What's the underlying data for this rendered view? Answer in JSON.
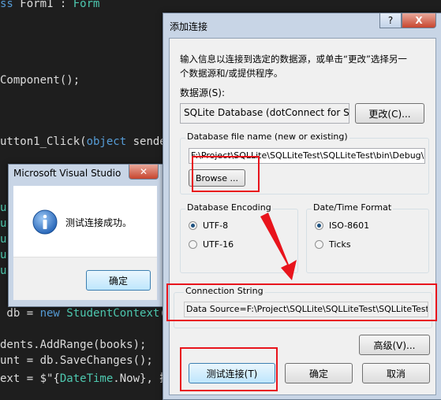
{
  "code_lines": {
    "l1_kw": "ss",
    "l1_name": " Form1 : ",
    "l1_type": "Form",
    "l2": "Component();",
    "l3_pre": "utton1_Click(",
    "l3_kw": "object",
    "l3_post": " sender",
    "l4_pre": " db = ",
    "l4_kw": "new",
    "l4_type": " StudentContext",
    "l4_post": "()",
    "l5": "dents.AddRange(books);",
    "l6": "unt = db.SaveChanges();",
    "l7_pre": "ext = $\"{",
    "l7_type": "DateTime",
    "l7_mid": ".Now}, 插"
  },
  "msgbox": {
    "title": "Microsoft Visual Studio",
    "message": "测试连接成功。",
    "ok_label": "确定",
    "icon": "info-icon"
  },
  "dialog": {
    "title": "添加连接",
    "help_label": "?",
    "close_label": "X",
    "intro_line1": "输入信息以连接到选定的数据源，或单击“更改”选择另一",
    "intro_line2": "个数据源和/或提供程序。",
    "datasource_label": "数据源(S):",
    "datasource_value": "SQLite Database (dotConnect for SQ",
    "change_label": "更改(C)...",
    "dbfile_group": "Database file name (new or existing)",
    "dbfile_value": "F:\\Project\\SQLLite\\SQLLiteTest\\SQLLiteTest\\bin\\Debug\\DB\\S",
    "browse_label": "Browse ...",
    "encoding_group": "Database Encoding",
    "encoding_options": [
      "UTF-8",
      "UTF-16"
    ],
    "encoding_selected": "UTF-8",
    "datetime_group": "Date/Time Format",
    "datetime_options": [
      "ISO-8601",
      "Ticks"
    ],
    "datetime_selected": "ISO-8601",
    "connstr_group": "Connection String",
    "connstr_value": "Data Source=F:\\Project\\SQLLite\\SQLLiteTest\\SQLLiteTest\\bin\\D",
    "advanced_label": "高级(V)...",
    "test_label": "测试连接(T)",
    "ok_label": "确定",
    "cancel_label": "取消"
  },
  "colors": {
    "annotation_red": "#e8141c",
    "keyword": "#569cd6",
    "type": "#4ec9b0"
  }
}
